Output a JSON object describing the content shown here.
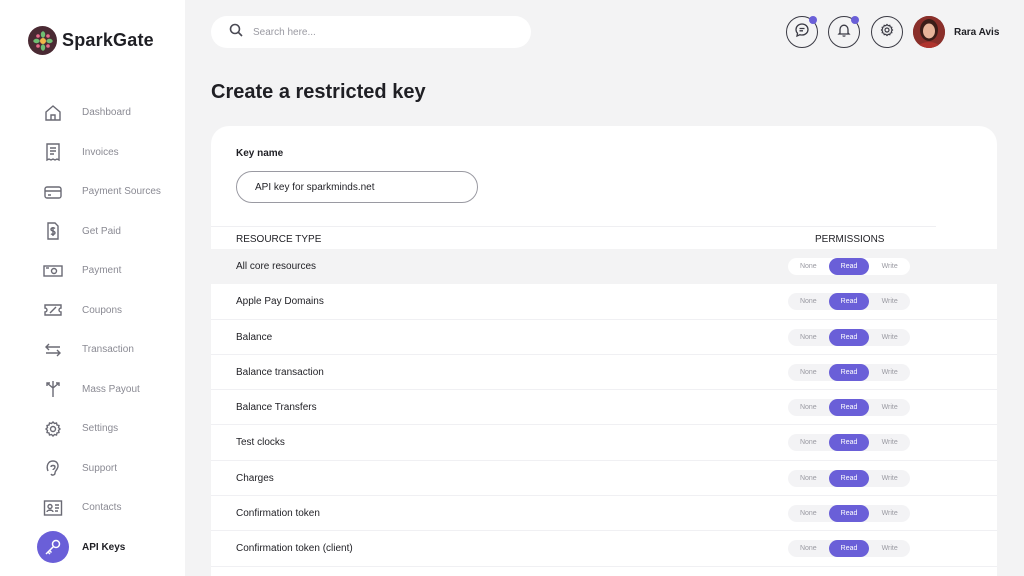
{
  "brand": {
    "name": "SparkGate",
    "accent": "#6a5fd8"
  },
  "sidebar": {
    "items": [
      {
        "label": "Dashboard",
        "icon": "home-icon",
        "active": false
      },
      {
        "label": "Invoices",
        "icon": "invoice-icon",
        "active": false
      },
      {
        "label": "Payment Sources",
        "icon": "credit-card-icon",
        "active": false
      },
      {
        "label": "Get Paid",
        "icon": "dollar-document-icon",
        "active": false
      },
      {
        "label": "Payment",
        "icon": "banknote-icon",
        "active": false
      },
      {
        "label": "Coupons",
        "icon": "ticket-icon",
        "active": false
      },
      {
        "label": "Transaction",
        "icon": "transfer-arrows-icon",
        "active": false
      },
      {
        "label": "Mass Payout",
        "icon": "split-arrows-icon",
        "active": false
      },
      {
        "label": "Settings",
        "icon": "gear-icon",
        "active": false
      },
      {
        "label": "Support",
        "icon": "headset-icon",
        "active": false
      },
      {
        "label": "Contacts",
        "icon": "contact-card-icon",
        "active": false
      },
      {
        "label": "API  Keys",
        "icon": "key-icon",
        "active": true
      }
    ]
  },
  "header": {
    "search_placeholder": "Search here...",
    "user_name": "Rara Avis"
  },
  "page": {
    "title": "Create a restricted key"
  },
  "form": {
    "key_name_label": "Key name",
    "key_name_value": "API key for sparkminds.net"
  },
  "table": {
    "col_resource": "RESOURCE TYPE",
    "col_permissions": "PERMISSIONS",
    "options": [
      "None",
      "Read",
      "Write"
    ],
    "rows": [
      {
        "label": "All core resources",
        "value": "Read"
      },
      {
        "label": "Apple Pay Domains",
        "value": "Read"
      },
      {
        "label": "Balance",
        "value": "Read"
      },
      {
        "label": "Balance transaction",
        "value": "Read"
      },
      {
        "label": "Balance Transfers",
        "value": "Read"
      },
      {
        "label": "Test clocks",
        "value": "Read"
      },
      {
        "label": "Charges",
        "value": "Read"
      },
      {
        "label": "Confirmation token",
        "value": "Read"
      },
      {
        "label": "Confirmation token (client)",
        "value": "Read"
      }
    ]
  }
}
